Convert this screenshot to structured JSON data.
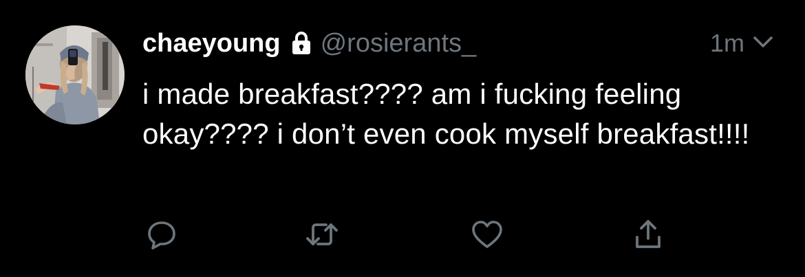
{
  "tweet": {
    "display_name": "chaeyoung",
    "handle": "@rosierants_",
    "timestamp": "1m",
    "protected": true,
    "text": "i made breakfast???? am i fucking feeling okay???? i don’t even cook myself breakfast!!!!"
  },
  "icons": {
    "lock": "lock-icon",
    "caret": "chevron-down-icon",
    "reply": "reply-icon",
    "retweet": "retweet-icon",
    "like": "heart-icon",
    "share": "share-icon"
  },
  "colors": {
    "background": "#000000",
    "primary_text": "#ffffff",
    "secondary_text": "#6e767d"
  }
}
